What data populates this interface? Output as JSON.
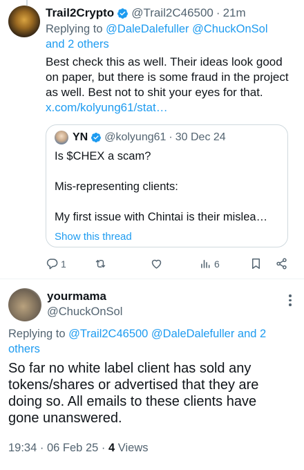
{
  "post1": {
    "name": "Trail2Crypto",
    "handle": "@Trail2C46500",
    "sep": "·",
    "time": "21m",
    "replying_prefix": "Replying to",
    "replying_mentions": "@DaleDalefuller @ChuckOnSol",
    "replying_others": "and 2 others",
    "body": "Best check this as well. Their ideas look good on paper, but there is some fraud in the project as well. Best not to shit your eyes for that.",
    "link": "x.com/kolyung61/stat…"
  },
  "quote": {
    "name": "YN",
    "handle": "@kolyung61",
    "sep": "·",
    "date": "30 Dec 24",
    "line1": "Is $CHEX a scam?",
    "line2": "Mis-representing clients:",
    "line3": "My first issue with Chintai is their mislea…",
    "show_thread": "Show this thread"
  },
  "actions": {
    "replies": "1",
    "views": "6",
    "icons": [
      "reply-icon",
      "retweet-icon",
      "like-icon",
      "views-icon",
      "bookmark-icon",
      "share-icon"
    ]
  },
  "post2": {
    "name": "yourmama",
    "handle": "@ChuckOnSol",
    "replying_prefix": "Replying to",
    "replying_mentions": "@Trail2C46500 @DaleDalefuller and 2 others",
    "body": "So far no white label client has sold any tokens/shares or advertised that they are doing so. All emails to these clients have gone unanswered.",
    "time": "19:34",
    "sep1": "·",
    "date": "06 Feb 25",
    "sep2": "·",
    "views": "4",
    "views_label": "Views"
  },
  "colors": {
    "link": "#1d9bf0",
    "muted": "#536471",
    "text": "#0f1419",
    "border": "#cfd9de"
  }
}
